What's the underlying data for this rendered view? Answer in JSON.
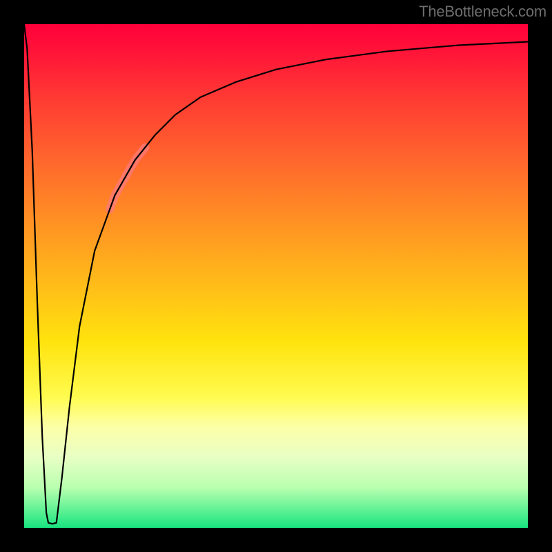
{
  "watermark": "TheBottleneck.com",
  "colors": {
    "frame": "#000000",
    "curve_stroke": "#000000",
    "highlight": "rgba(255,122,122,0.78)"
  },
  "chart_data": {
    "type": "line",
    "title": "",
    "xlabel": "",
    "ylabel": "",
    "xlim": [
      0,
      100
    ],
    "ylim": [
      0,
      100
    ],
    "grid": false,
    "legend": false,
    "background_gradient": {
      "orientation": "vertical",
      "stops": [
        {
          "pos": 0.0,
          "color": "#ff003a"
        },
        {
          "pos": 0.15,
          "color": "#ff3b33"
        },
        {
          "pos": 0.45,
          "color": "#ffa51f"
        },
        {
          "pos": 0.63,
          "color": "#ffe30e"
        },
        {
          "pos": 0.8,
          "color": "#fdffa8"
        },
        {
          "pos": 1.0,
          "color": "#18e37f"
        }
      ]
    },
    "series": [
      {
        "name": "left-drop",
        "x": [
          0.0,
          0.6,
          1.6,
          2.6,
          3.6,
          4.4,
          4.8
        ],
        "y": [
          100,
          95,
          75,
          45,
          18,
          3,
          1
        ]
      },
      {
        "name": "notch-floor",
        "x": [
          4.8,
          5.6,
          6.4
        ],
        "y": [
          1,
          0.8,
          1
        ]
      },
      {
        "name": "right-rise",
        "x": [
          6.4,
          7.5,
          9.0,
          11,
          14,
          18,
          22,
          26,
          30,
          35,
          42,
          50,
          60,
          72,
          86,
          100
        ],
        "y": [
          1,
          10,
          24,
          40,
          55,
          66,
          73,
          78,
          82,
          85.5,
          88.5,
          91,
          93,
          94.6,
          95.8,
          96.5
        ]
      }
    ],
    "highlight_segment": {
      "series": "right-rise",
      "x_range": [
        17,
        24
      ],
      "y_range": [
        64,
        75
      ]
    }
  }
}
